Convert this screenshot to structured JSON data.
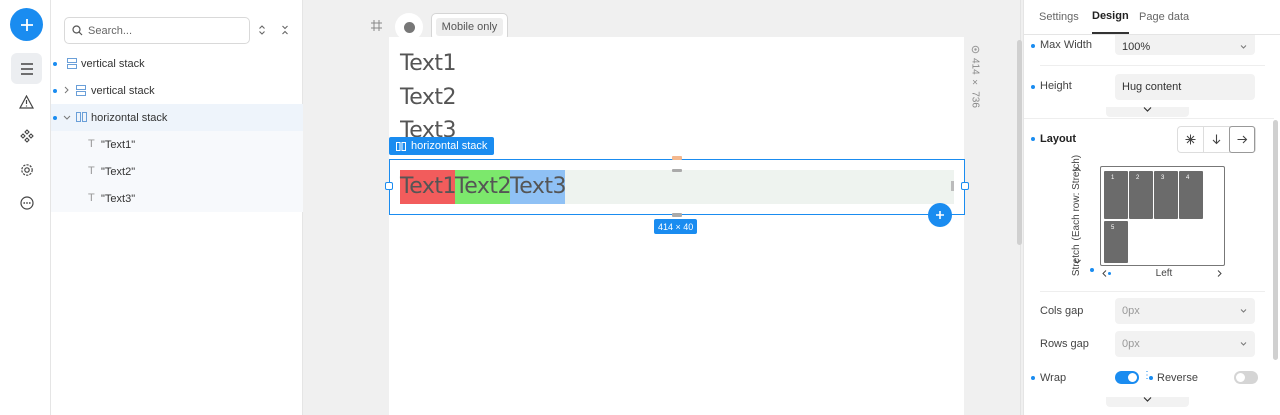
{
  "sidebar_rail": {
    "add_icon": "plus-icon",
    "items": [
      "layers-icon",
      "warning-icon",
      "components-icon",
      "gear-icon",
      "more-icon"
    ]
  },
  "tree": {
    "search_placeholder": "Search...",
    "items": [
      {
        "label": "vertical stack"
      },
      {
        "label": "vertical stack"
      },
      {
        "label": "horizontal stack"
      },
      {
        "label": "\"Text1\""
      },
      {
        "label": "\"Text2\""
      },
      {
        "label": "\"Text3\""
      }
    ]
  },
  "canvas": {
    "toolbar": {
      "mode_label": "Mobile only"
    },
    "frame_size_label": "414 × 736",
    "texts": [
      "Text1",
      "Text2",
      "Text3"
    ],
    "selection_label": "horizontal stack",
    "selection_size": "414 × 40",
    "stack_items": [
      {
        "text": "Text1",
        "color": "#f25c5c"
      },
      {
        "text": "Text2",
        "color": "#7ce86c"
      },
      {
        "text": "Text3",
        "color": "#8fc1f5"
      }
    ],
    "accent": "#1a8cf0"
  },
  "panel": {
    "tabs": [
      "Settings",
      "Design",
      "Page data"
    ],
    "active_tab": "Design",
    "max_width": {
      "label": "Max Width",
      "value": "100%"
    },
    "height": {
      "label": "Height",
      "value": "Hug content"
    },
    "layout": {
      "label": "Layout",
      "vertical_label": "Stretch",
      "vertical_sub": "Each row: Stretch",
      "horizontal_label": "Left",
      "cells": [
        "1",
        "2",
        "3",
        "4",
        "5"
      ]
    },
    "cols_gap": {
      "label": "Cols gap",
      "placeholder": "0px"
    },
    "rows_gap": {
      "label": "Rows gap",
      "placeholder": "0px"
    },
    "wrap": {
      "label": "Wrap",
      "on": true
    },
    "reverse": {
      "label": "Reverse",
      "on": false
    }
  }
}
